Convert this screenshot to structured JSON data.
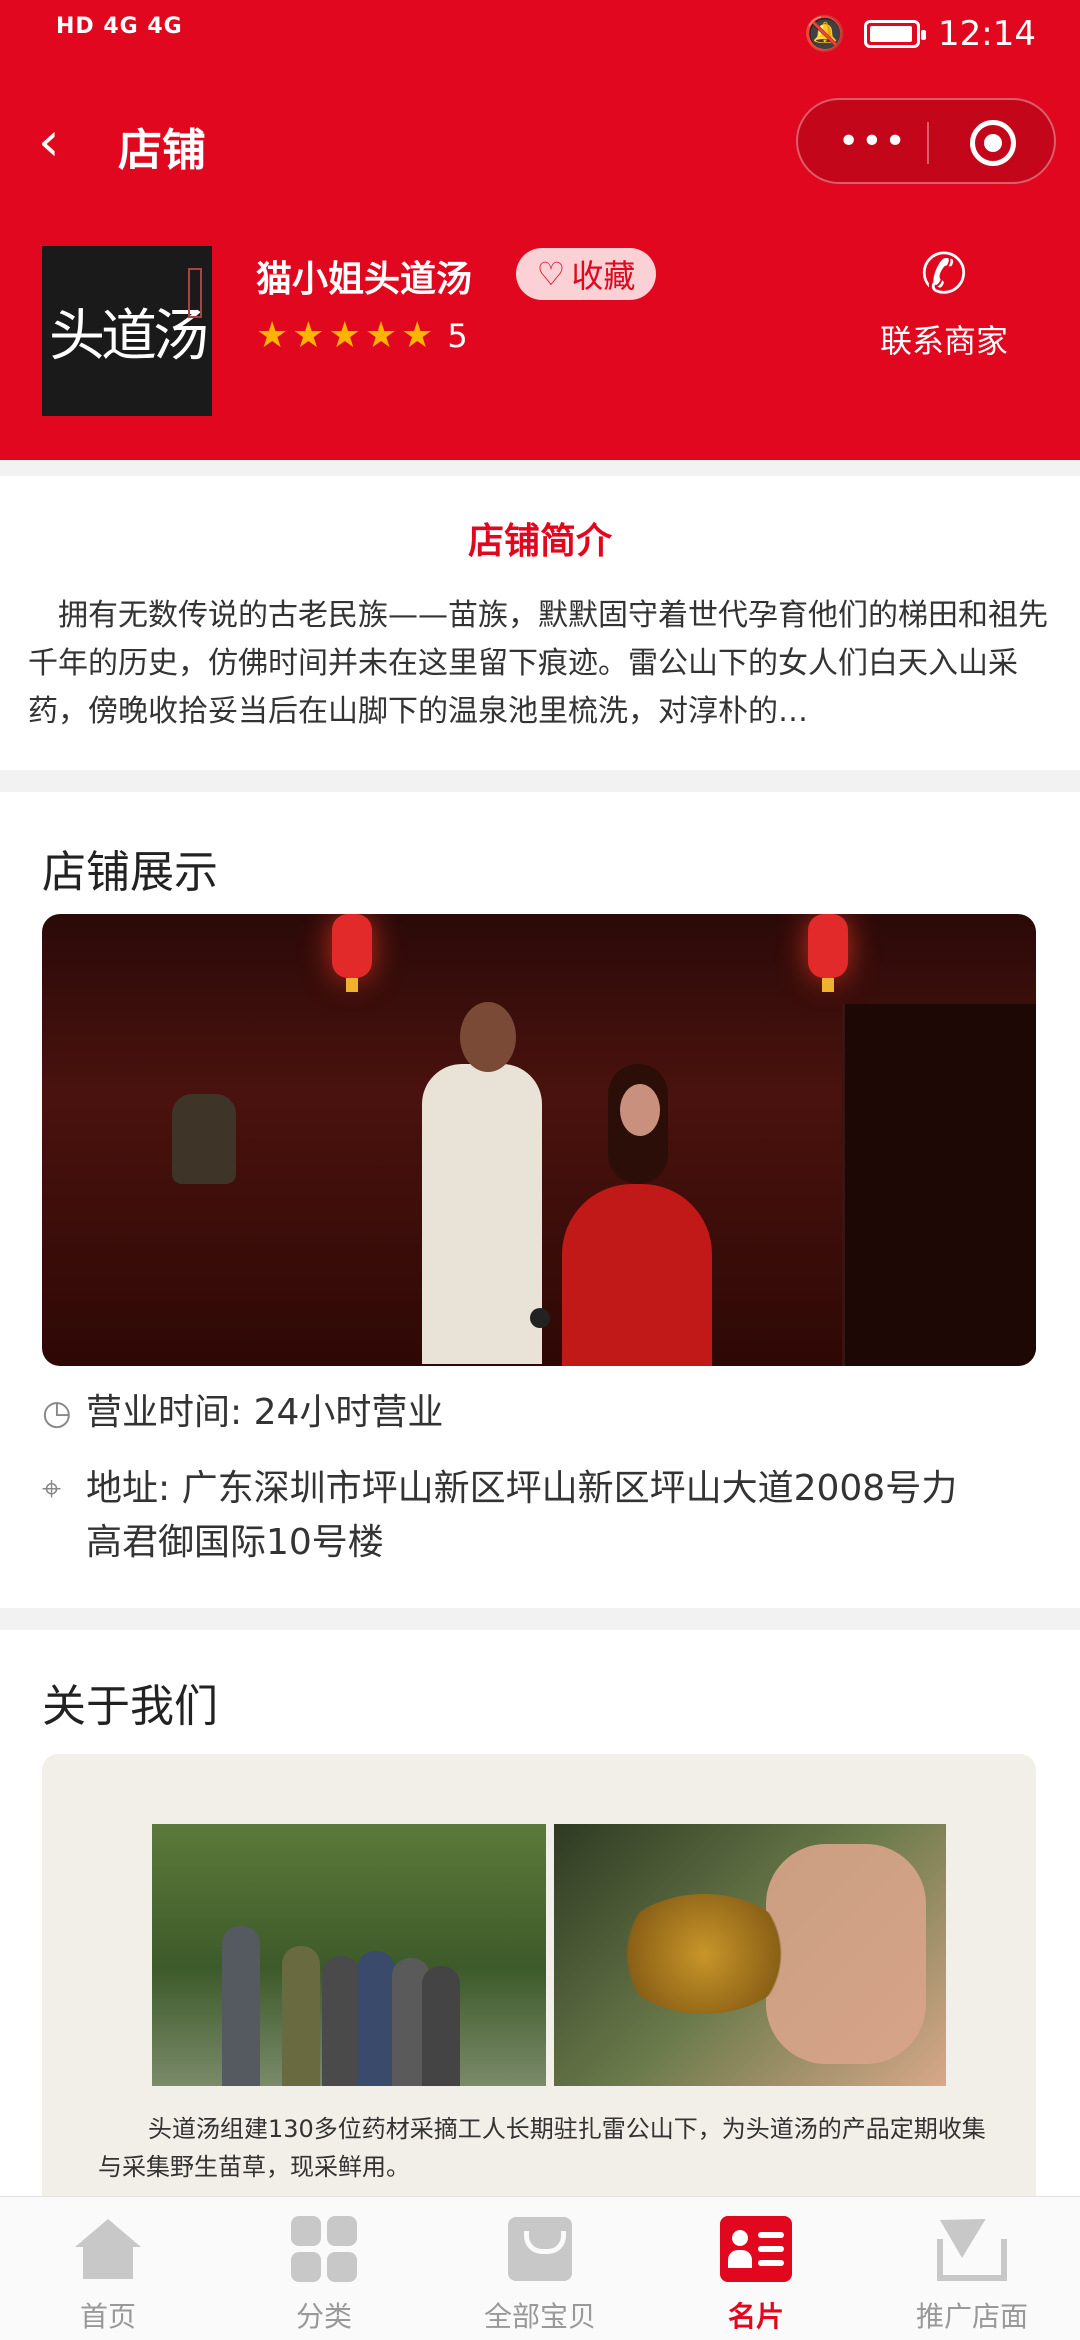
{
  "status_bar": {
    "signal_text": "HD 4G 4G",
    "time": "12:14"
  },
  "nav": {
    "back_icon": "chevron-left-icon",
    "title": "店铺",
    "menu_icon": "more-dots-icon",
    "close_icon": "target-circle-icon"
  },
  "shop": {
    "logo_text": "头道汤",
    "name": "猫小姐头道汤",
    "favorite_label": "收藏",
    "rating": "5",
    "star_count": 5,
    "contact_label": "联系商家"
  },
  "intro": {
    "title": "店铺简介",
    "text": "拥有无数传说的古老民族——苗族，默默固守着世代孕育他们的梯田和祖先千年的历史，仿佛时间并未在这里留下痕迹。雷公山下的女人们白天入山采药，傍晚收拾妥当后在山脚下的温泉池里梳洗，对淳朴的…"
  },
  "showcase": {
    "title": "店铺展示",
    "hours": "营业时间: 24小时营业",
    "address": "地址: 广东深圳市坪山新区坪山新区坪山大道2008号力高君御国际10号楼"
  },
  "about": {
    "title": "关于我们",
    "caption": "头道汤组建130多位药材采摘工人长期驻扎雷公山下，为头道汤的产品定期收集与采集野生苗草，现采鲜用。"
  },
  "tabs": [
    {
      "label": "首页",
      "icon": "home-icon"
    },
    {
      "label": "分类",
      "icon": "category-icon"
    },
    {
      "label": "全部宝贝",
      "icon": "shopping-bag-icon"
    },
    {
      "label": "名片",
      "icon": "business-card-icon"
    },
    {
      "label": "推广店面",
      "icon": "share-icon"
    }
  ],
  "colors": {
    "brand": "#e0071e",
    "star": "#ffb400",
    "tab_inactive": "#999999"
  }
}
